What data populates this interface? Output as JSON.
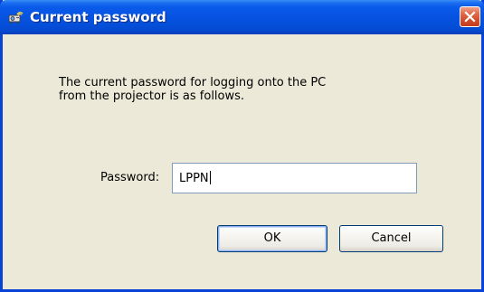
{
  "window": {
    "title": "Current password",
    "title_icon": "projector-network-icon",
    "close_icon": "close-icon"
  },
  "message": {
    "line1": "The current password for logging onto the PC",
    "line2": "from the projector is as follows."
  },
  "password": {
    "label": "Password:",
    "value": "LPPN"
  },
  "buttons": {
    "ok_label": "OK",
    "cancel_label": "Cancel"
  },
  "colors": {
    "titlebar": "#0754e3",
    "close_button": "#d24a2a",
    "dialog_background": "#ece9d8",
    "input_border": "#7f9db9"
  }
}
